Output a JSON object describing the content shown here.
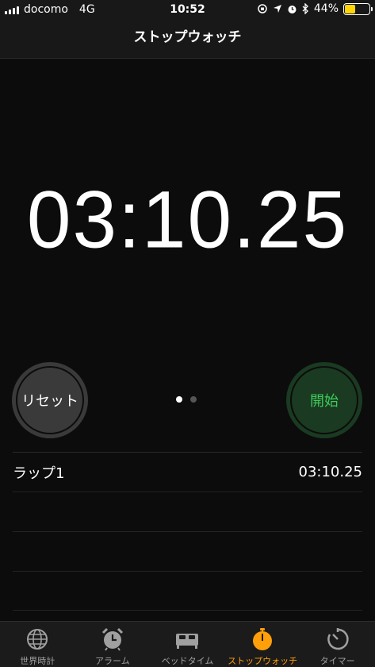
{
  "status_bar": {
    "carrier": "docomo",
    "network": "4G",
    "time": "10:52",
    "battery_percent": "44%",
    "battery_level": 0.44,
    "icons": [
      "orientation-lock-icon",
      "location-arrow-icon",
      "alarm-icon",
      "bluetooth-icon"
    ]
  },
  "navbar": {
    "title": "ストップウォッチ"
  },
  "timer": {
    "display": "03:10.25"
  },
  "controls": {
    "reset_label": "リセット",
    "start_label": "開始",
    "page_dots": 2,
    "active_dot": 0
  },
  "laps": [
    {
      "label": "ラップ1",
      "time": "03:10.25"
    }
  ],
  "tabs": [
    {
      "label": "世界時計",
      "icon": "globe-icon",
      "active": false
    },
    {
      "label": "アラーム",
      "icon": "alarm-clock-icon",
      "active": false
    },
    {
      "label": "ベッドタイム",
      "icon": "bed-icon",
      "active": false
    },
    {
      "label": "ストップウォッチ",
      "icon": "stopwatch-icon",
      "active": true
    },
    {
      "label": "タイマー",
      "icon": "timer-icon",
      "active": false
    }
  ],
  "colors": {
    "accent": "#ff9f0a",
    "start_green": "#3ecc5b",
    "start_bg": "#1a3a21",
    "reset_bg": "#3a3a3a",
    "battery": "#ffd60a"
  }
}
